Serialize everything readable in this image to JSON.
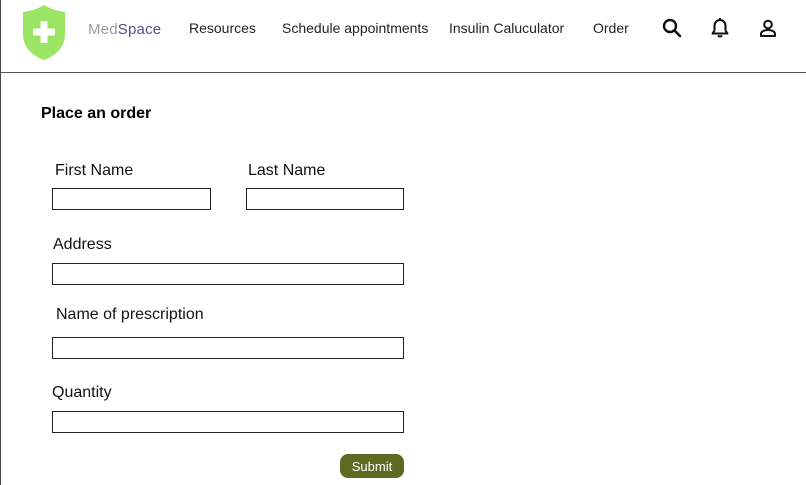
{
  "colors": {
    "logo_shield": "#9be564",
    "logo_cross": "#ffffff",
    "brand_med": "#9a9a9a",
    "brand_space": "#5b4b8a",
    "submit_bg": "#5c6b22"
  },
  "header": {
    "brand_part1": "Med",
    "brand_part2": "Space",
    "nav": [
      {
        "label": "Resources"
      },
      {
        "label": "Schedule appointments"
      },
      {
        "label": "Insulin Caluculator"
      },
      {
        "label": "Order"
      }
    ],
    "icons": [
      "search-icon",
      "bell-icon",
      "user-icon"
    ]
  },
  "form": {
    "title": "Place an order",
    "first_name": {
      "label": "First Name",
      "value": ""
    },
    "last_name": {
      "label": "Last Name",
      "value": ""
    },
    "address": {
      "label": "Address",
      "value": ""
    },
    "prescription": {
      "label": "Name of prescription",
      "value": ""
    },
    "quantity": {
      "label": "Quantity",
      "value": ""
    },
    "submit_label": "Submit"
  }
}
